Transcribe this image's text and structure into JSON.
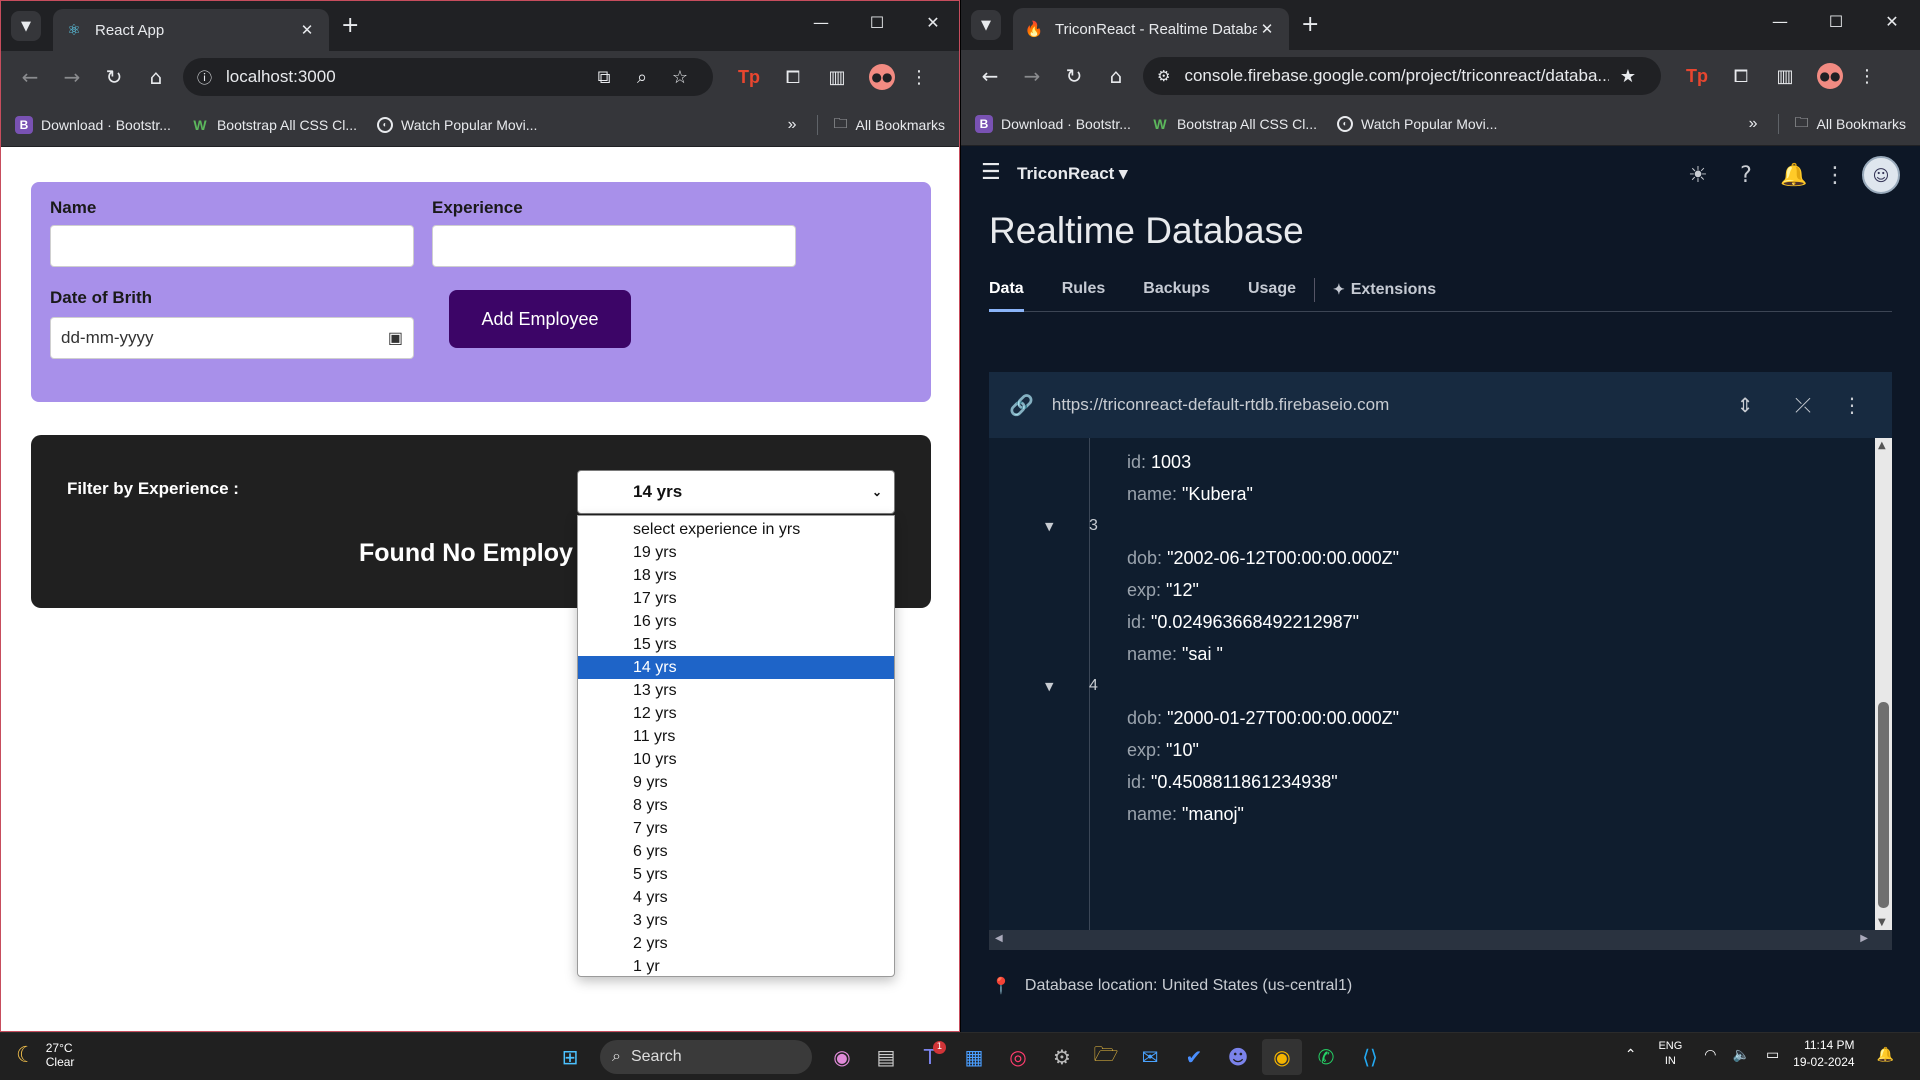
{
  "left_window": {
    "tab_title": "React App",
    "url": "localhost:3000",
    "bookmarks": [
      "Download · Bootstr...",
      "Bootstrap All CSS Cl...",
      "Watch Popular Movi..."
    ],
    "all_bookmarks": "All Bookmarks",
    "form": {
      "name_label": "Name",
      "experience_label": "Experience",
      "dob_label": "Date of Brith",
      "dob_placeholder": "dd-mm-yyyy",
      "add_button": "Add Employee"
    },
    "filter": {
      "label": "Filter by Experience :",
      "selected": "14 yrs",
      "empty_message": "Found No Employ",
      "options": [
        "select experience in yrs",
        "19 yrs",
        "18 yrs",
        "17 yrs",
        "16 yrs",
        "15 yrs",
        "14 yrs",
        "13 yrs",
        "12 yrs",
        "11 yrs",
        "10 yrs",
        "9 yrs",
        "8 yrs",
        "7 yrs",
        "6 yrs",
        "5 yrs",
        "4 yrs",
        "3 yrs",
        "2 yrs",
        "1 yr"
      ],
      "selected_index": 6
    }
  },
  "right_window": {
    "tab_title": "TriconReact - Realtime Databas",
    "url": "console.firebase.google.com/project/triconreact/databa...",
    "bookmarks": [
      "Download · Bootstr...",
      "Bootstrap All CSS Cl...",
      "Watch Popular Movi..."
    ],
    "all_bookmarks": "All Bookmarks",
    "project": "TriconReact",
    "title": "Realtime Database",
    "tabs": [
      "Data",
      "Rules",
      "Backups",
      "Usage"
    ],
    "extensions_tab": "Extensions",
    "db_url": "https://triconreact-default-rtdb.firebaseio.com",
    "tree": {
      "top_partial": [
        {
          "key": "id:",
          "value": "1003"
        },
        {
          "key": "name:",
          "value": "\"Kubera\""
        }
      ],
      "nodes": [
        {
          "index": "3",
          "fields": [
            {
              "key": "dob:",
              "value": "\"2002-06-12T00:00:00.000Z\""
            },
            {
              "key": "exp:",
              "value": "\"12\""
            },
            {
              "key": "id:",
              "value": "\"0.024963668492212987\""
            },
            {
              "key": "name:",
              "value": "\"sai \""
            }
          ]
        },
        {
          "index": "4",
          "fields": [
            {
              "key": "dob:",
              "value": "\"2000-01-27T00:00:00.000Z\""
            },
            {
              "key": "exp:",
              "value": "\"10\""
            },
            {
              "key": "id:",
              "value": "\"0.4508811861234938\""
            },
            {
              "key": "name:",
              "value": "\"manoj\""
            }
          ]
        }
      ]
    },
    "db_location": "Database location: United States (us-central1)"
  },
  "taskbar": {
    "temp": "27°C",
    "weather": "Clear",
    "search": "Search",
    "lang_line1": "ENG",
    "lang_line2": "IN",
    "time": "11:14 PM",
    "date": "19-02-2024",
    "teams_badge": "1"
  },
  "colors": {
    "form_bg": "#a890ea",
    "button_bg": "#3c0567",
    "selected_option": "#1e64c8",
    "firebase_bg": "#0d1726"
  }
}
